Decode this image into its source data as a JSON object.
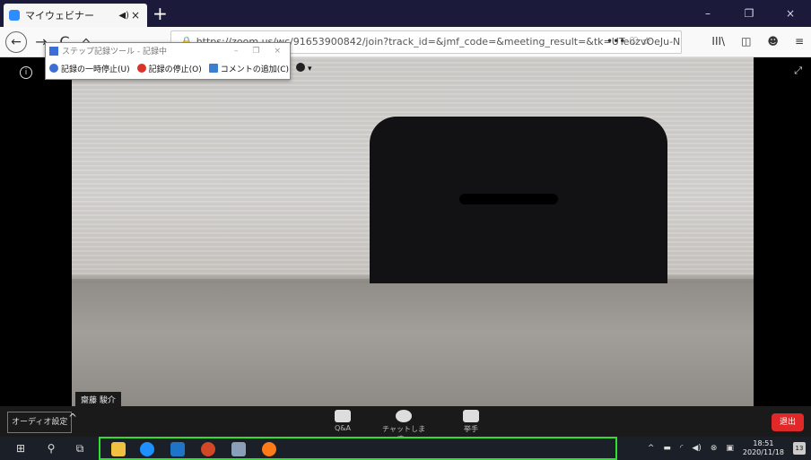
{
  "browser": {
    "tab_title": "マイウェビナー",
    "tab_audio": "◀)",
    "tab_close": "×",
    "new_tab": "+",
    "win_min": "–",
    "win_max": "❐",
    "win_close": "×",
    "url": "https://zoom.us/wc/91653900842/join?track_id=&jmf_code=&meeting_result=&tk=UTeozvOeJu-N",
    "page_actions": "••• ♡ ☆",
    "back_label": "←",
    "forward_label": "→",
    "reload_label": "C",
    "home_label": "⌂",
    "toolbar_icons": [
      "III\\",
      "◫",
      "☻",
      "≡"
    ]
  },
  "steps_recorder": {
    "title": "ステップ記録ツール - 記録中",
    "pause_label": "記録の一時停止(U)",
    "stop_label": "記録の停止(O)",
    "comment_label": "コメントの追加(C)",
    "help_caret": "▾"
  },
  "meeting": {
    "participant_name": "齋藤 駿介"
  },
  "controls": {
    "audio_settings": "オーディオ設定",
    "qa_label": "Q&A",
    "chat_label": "チャットします。",
    "raise_hand_label": "挙手",
    "leave_label": "退出"
  },
  "taskbar": {
    "time": "18:51",
    "date": "2020/11/18",
    "notification_count": "13"
  },
  "colors": {
    "accent_green": "#2fe02f",
    "leave_red": "#e02828",
    "zoom_blue": "#2d8cff"
  }
}
